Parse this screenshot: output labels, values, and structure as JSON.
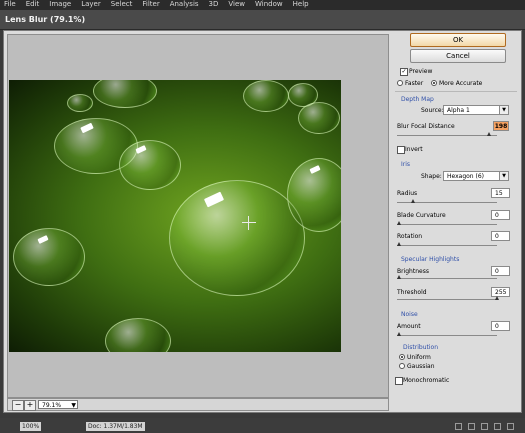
{
  "menubar": {
    "items": [
      "File",
      "Edit",
      "Image",
      "Layer",
      "Select",
      "Filter",
      "Analysis",
      "3D",
      "View",
      "Window",
      "Help"
    ]
  },
  "dialog": {
    "title": "Lens Blur (79.1%)"
  },
  "buttons": {
    "ok": "OK",
    "cancel": "Cancel"
  },
  "preview": {
    "checkbox_label": "Preview",
    "checked": true,
    "quality": {
      "faster": "Faster",
      "more_accurate": "More Accurate",
      "selected": "More Accurate"
    }
  },
  "depth_map": {
    "heading": "Depth Map",
    "source_label": "Source:",
    "source_value": "Alpha 1",
    "focal_label": "Blur Focal Distance",
    "focal_value": "198",
    "invert_label": "Invert",
    "invert_checked": false
  },
  "iris": {
    "heading": "Iris",
    "shape_label": "Shape:",
    "shape_value": "Hexagon (6)",
    "radius_label": "Radius",
    "radius_value": "15",
    "curvature_label": "Blade Curvature",
    "curvature_value": "0",
    "rotation_label": "Rotation",
    "rotation_value": "0"
  },
  "specular": {
    "heading": "Specular Highlights",
    "brightness_label": "Brightness",
    "brightness_value": "0",
    "threshold_label": "Threshold",
    "threshold_value": "255"
  },
  "noise": {
    "heading": "Noise",
    "amount_label": "Amount",
    "amount_value": "0",
    "distribution_heading": "Distribution",
    "uniform": "Uniform",
    "gaussian": "Gaussian",
    "selected": "Uniform",
    "mono_label": "Monochromatic",
    "mono_checked": false
  },
  "zoom": {
    "minus": "−",
    "plus": "+",
    "value": "79.1%"
  },
  "status": {
    "zoom": "100%",
    "doc": "Doc: 1.37M/1.83M"
  },
  "colors": {
    "accent": "#2f4fa8",
    "focal_highlight": "#f4a060",
    "leaf": "#4f8a16"
  }
}
